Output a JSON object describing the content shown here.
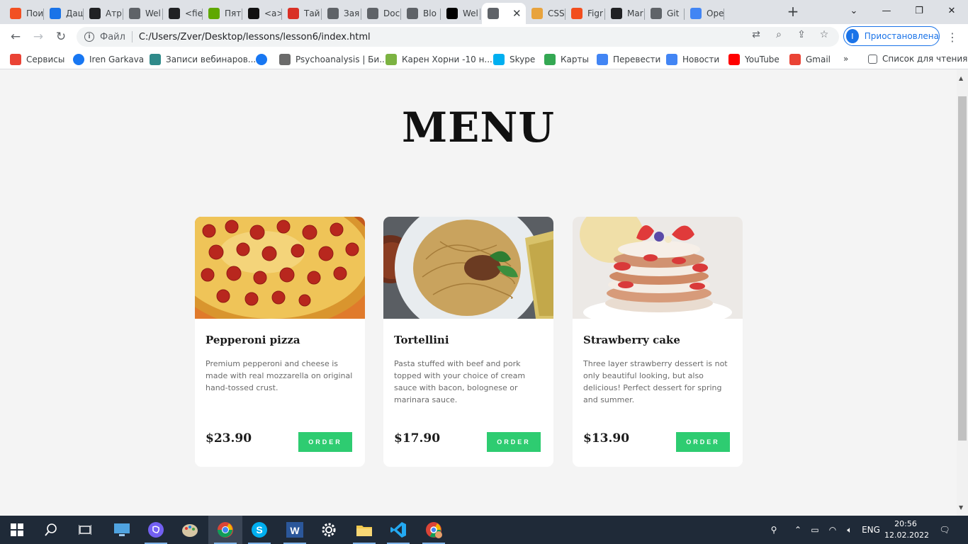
{
  "browser": {
    "tabs": [
      {
        "label": "Пои",
        "icon": "windows-logo-icon",
        "color": "#f25022"
      },
      {
        "label": "Даш",
        "icon": "edge-pen-icon",
        "color": "#1a73e8"
      },
      {
        "label": "Атр",
        "icon": "speech-bubble-icon",
        "color": "#202124"
      },
      {
        "label": "Wel",
        "icon": "anchor-icon",
        "color": "#5f6368"
      },
      {
        "label": "<fie",
        "icon": "speech-bubble-icon",
        "color": "#202124"
      },
      {
        "label": "Пят",
        "icon": "deliver-logo-icon",
        "color": "#5fa800"
      },
      {
        "label": "<a>",
        "icon": "code-block-icon",
        "color": "#111111"
      },
      {
        "label": "Тай",
        "icon": "cube-icon",
        "color": "#d93025"
      },
      {
        "label": "Зая",
        "icon": "globe-icon",
        "color": "#5f6368"
      },
      {
        "label": "Doc",
        "icon": "globe-icon",
        "color": "#5f6368"
      },
      {
        "label": "Blo",
        "icon": "globe-icon",
        "color": "#5f6368"
      },
      {
        "label": "Wel",
        "icon": "jetbrains-icon",
        "color": "#000000"
      },
      {
        "label": "",
        "icon": "globe-icon",
        "color": "#5f6368",
        "active": true
      },
      {
        "label": "CSS",
        "icon": "css-logo-icon",
        "color": "#e8a33d"
      },
      {
        "label": "Figr",
        "icon": "figma-icon",
        "color": "#f24e1e"
      },
      {
        "label": "Mar",
        "icon": "github-icon",
        "color": "#202124"
      },
      {
        "label": "Git",
        "icon": "globe-icon",
        "color": "#5f6368"
      },
      {
        "label": "Ope",
        "icon": "apps-icon",
        "color": "#4285f4"
      }
    ],
    "close_glyph": "✕",
    "new_tab_glyph": "+",
    "address": {
      "file_label": "Файл",
      "url": "C:/Users/Zver/Desktop/lessons/lesson6/index.html"
    },
    "profile_label": "Приостановлена",
    "profile_initial": "I",
    "bookmarks": [
      {
        "label": "Сервисы",
        "icon": "apps-grid-icon",
        "color": "#ea4335"
      },
      {
        "label": "Iren Garkava",
        "icon": "facebook-icon",
        "color": "#1877f2"
      },
      {
        "label": "Записи вебинаров...",
        "icon": "webinar-icon",
        "color": "#2f8a8a"
      },
      {
        "label": "",
        "icon": "facebook-icon",
        "color": "#1877f2"
      },
      {
        "label": "Psychoanalysis | Би...",
        "icon": "psy-icon",
        "color": "#6b6b6b"
      },
      {
        "label": "Карен Хорни -10 н...",
        "icon": "leaf-icon",
        "color": "#7cb342"
      },
      {
        "label": "Skype",
        "icon": "skype-icon",
        "color": "#00aff0"
      },
      {
        "label": "Карты",
        "icon": "maps-icon",
        "color": "#34a853"
      },
      {
        "label": "Перевести",
        "icon": "translate-icon",
        "color": "#4285f4"
      },
      {
        "label": "Новости",
        "icon": "news-icon",
        "color": "#4285f4"
      },
      {
        "label": "YouTube",
        "icon": "youtube-icon",
        "color": "#ff0000"
      },
      {
        "label": "Gmail",
        "icon": "gmail-icon",
        "color": "#ea4335"
      }
    ],
    "bookmarks_overflow": "»",
    "reading_list": "Список для чтения"
  },
  "page": {
    "title": "MENU",
    "accent": "#2ecc71",
    "cards": [
      {
        "title": "Pepperoni pizza",
        "description": "Premium pepperoni and cheese is made with real mozzarella on original hand-tossed crust.",
        "price": "$23.90",
        "order_label": "ORDER",
        "image": "pizza-photo"
      },
      {
        "title": "Tortellini",
        "description": "Pasta stuffed with beef and pork topped with your choice of cream sauce with bacon, bolognese or marinara sauce.",
        "price": "$17.90",
        "order_label": "ORDER",
        "image": "pasta-photo"
      },
      {
        "title": "Strawberry cake",
        "description": "Three layer strawberry dessert is not only beautiful looking, but also delicious! Perfect dessert for spring and summer.",
        "price": "$13.90",
        "order_label": "ORDER",
        "image": "cake-photo"
      }
    ]
  },
  "taskbar": {
    "language": "ENG",
    "time": "20:56",
    "date": "12.02.2022"
  }
}
